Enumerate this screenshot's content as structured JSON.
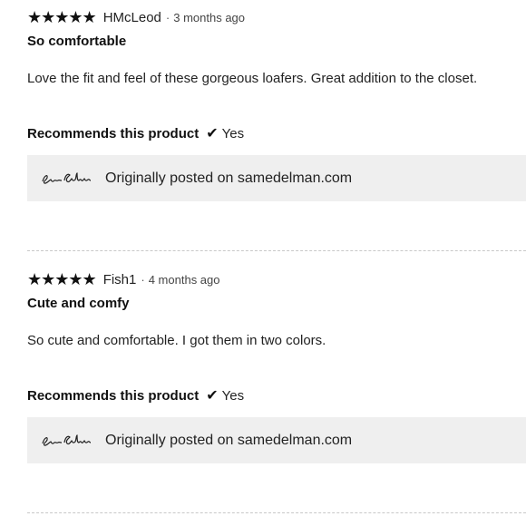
{
  "reviews": [
    {
      "stars": "★★★★★",
      "author": "HMcLeod",
      "separator": "·",
      "time": "3 months ago",
      "title": "So comfortable",
      "body": "Love the fit and feel of these gorgeous loafers. Great addition to the closet.",
      "recommend_label": "Recommends this product",
      "recommend_icon": "check-icon",
      "recommend_value": "Yes",
      "source_logo": "Sam Edelman",
      "source_text": "Originally posted on samedelman.com"
    },
    {
      "stars": "★★★★★",
      "author": "Fish1",
      "separator": "·",
      "time": "4 months ago",
      "title": "Cute and comfy",
      "body": "So cute and comfortable. I got them in two colors.",
      "recommend_label": "Recommends this product",
      "recommend_icon": "check-icon",
      "recommend_value": "Yes",
      "source_logo": "Sam Edelman",
      "source_text": "Originally posted on samedelman.com"
    }
  ],
  "colors": {
    "source_box_bg": "#efefef",
    "divider": "#c8c8c8"
  }
}
